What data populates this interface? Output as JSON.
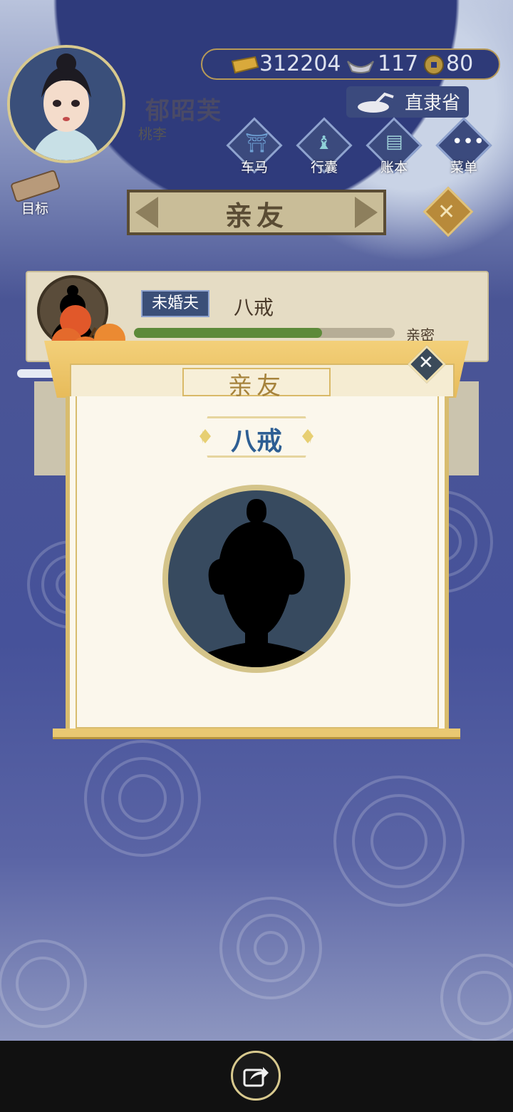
{
  "player": {
    "name": "郁昭芙",
    "sub": "桃李"
  },
  "currency": {
    "gold": "312204",
    "silver": "117",
    "coins": "80"
  },
  "location": "直隶省",
  "nav": [
    {
      "label": "车马",
      "icon": "carriage-icon"
    },
    {
      "label": "行囊",
      "icon": "bag-icon"
    },
    {
      "label": "账本",
      "icon": "ledger-icon"
    },
    {
      "label": "菜单",
      "icon": "menu-dots-icon"
    }
  ],
  "target_label": "目标",
  "page_title": "亲友",
  "friend": {
    "relation": "未婚夫",
    "name": "八戒",
    "intimacy_label": "亲密",
    "intimacy_fraction": 0.72
  },
  "modal": {
    "title": "亲友",
    "name": "八戒"
  },
  "colors": {
    "accent_gold": "#d8bc6e",
    "name_blue": "#2d5e93",
    "badge_blue": "#3b4f78",
    "intimacy_green": "#5d8a3a"
  }
}
